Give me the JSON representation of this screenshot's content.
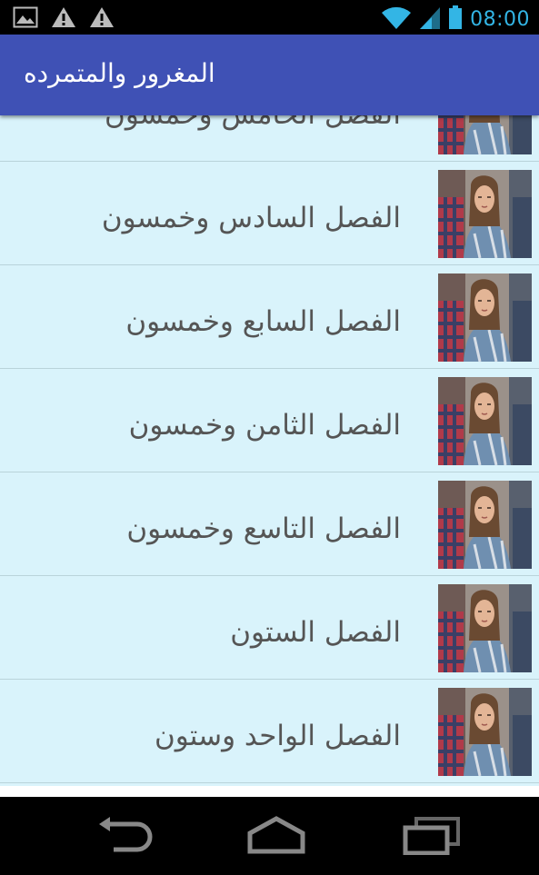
{
  "status_bar": {
    "time": "08:00",
    "icons": [
      "gallery-icon",
      "warning-icon",
      "warning-icon",
      "wifi-icon",
      "signal-icon",
      "battery-icon"
    ]
  },
  "app_bar": {
    "title": "المغرور والمتمرده"
  },
  "chapters": [
    "الفصل الخامس وخمسون",
    "الفصل السادس وخمسون",
    "الفصل السابع وخمسون",
    "الفصل الثامن وخمسون",
    "الفصل التاسع وخمسون",
    "الفصل الستون",
    "الفصل الواحد وستون"
  ],
  "nav_bar": {
    "buttons": [
      "back-icon",
      "home-icon",
      "recents-icon"
    ]
  },
  "colors": {
    "app_bar": "#3f51b5",
    "list_background": "#d9f3fb",
    "status_accent": "#33b5e5"
  }
}
